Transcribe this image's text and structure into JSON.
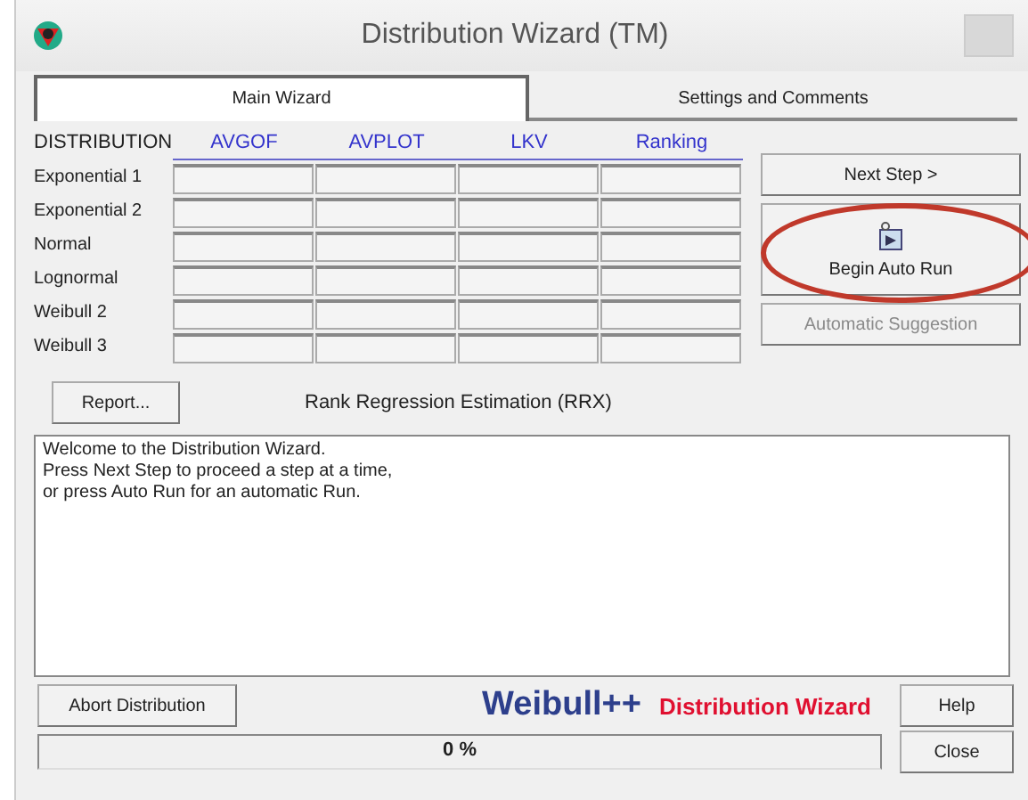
{
  "window": {
    "title": "Distribution Wizard (TM)"
  },
  "tabs": [
    {
      "label": "Main Wizard",
      "selected": true
    },
    {
      "label": "Settings and Comments",
      "selected": false
    }
  ],
  "grid": {
    "corner": "DISTRIBUTION",
    "columns": [
      "AVGOF",
      "AVPLOT",
      "LKV",
      "Ranking"
    ],
    "rows": [
      "Exponential 1",
      "Exponential 2",
      "Normal",
      "Lognormal",
      "Weibull 2",
      "Weibull 3"
    ]
  },
  "side_buttons": [
    {
      "label": "Next Step >",
      "kind": "text",
      "disabled": false
    },
    {
      "label": "Begin Auto Run",
      "kind": "icon",
      "disabled": false
    },
    {
      "label": "Automatic Suggestion",
      "kind": "text",
      "disabled": true
    }
  ],
  "report_button": "Report...",
  "method": "Rank Regression Estimation (RRX)",
  "log": [
    "Welcome to the Distribution Wizard.",
    "Press Next Step to proceed a step at a time,",
    "or press Auto Run for an automatic Run."
  ],
  "abort_button": "Abort Distribution",
  "brand": {
    "product": "Weibull++",
    "module": "Distribution Wizard"
  },
  "help_button": "Help",
  "progress": {
    "level": 0,
    "reading": "0 %"
  },
  "close_button": "Close"
}
